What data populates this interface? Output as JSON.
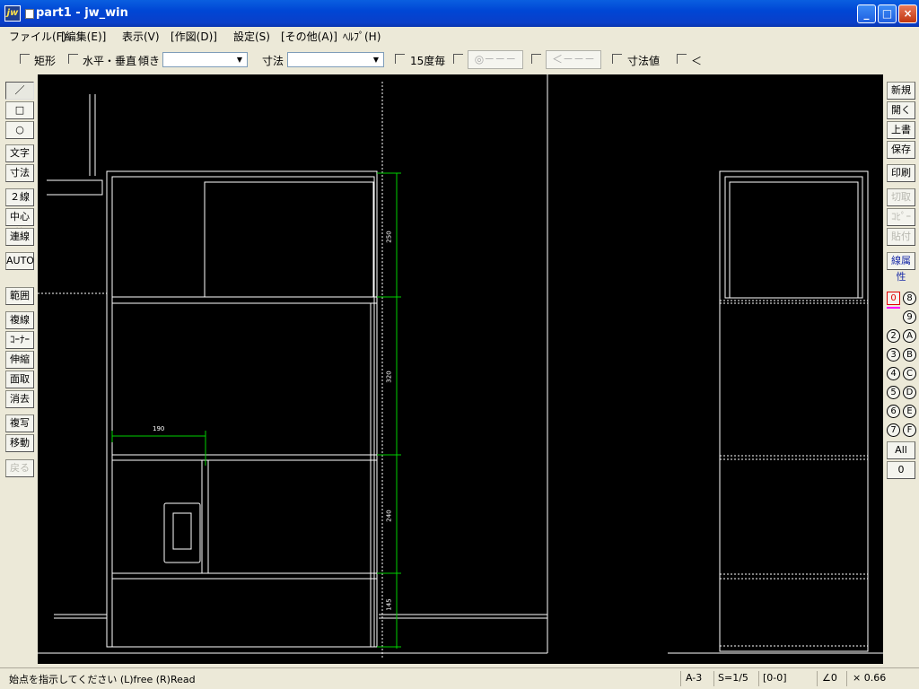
{
  "window": {
    "app_icon": "jw",
    "title": "part1 - jw_win",
    "min_label": "_",
    "max_label": "□",
    "close_label": "×"
  },
  "menu": [
    "ファイル(F)",
    "[編集(E)]",
    "表示(V)",
    "[作図(D)]",
    "設定(S)",
    "[その他(A)]",
    "ﾍﾙﾌﾟ(H)"
  ],
  "toolbar": {
    "rect": "矩形",
    "horiz_vert": "水平・垂直",
    "tilt": "傾き",
    "dim": "寸法",
    "deg15": "15度毎",
    "arrow1": "◎－－－",
    "arrow2": "＜－－－",
    "dimval": "寸法値",
    "lt": "＜"
  },
  "left_tools": [
    "／",
    "□",
    "○",
    "文字",
    "寸法",
    "２線",
    "中心線",
    "連線",
    "AUTO",
    "範囲",
    "複線",
    "ｺｰﾅｰ",
    "伸縮",
    "面取",
    "消去",
    "複写",
    "移動",
    "戻る"
  ],
  "right_tools": [
    "新規",
    "開く",
    "上書",
    "保存",
    "印刷",
    "切取",
    "ｺﾋﾟｰ",
    "貼付",
    "線属性"
  ],
  "layers": {
    "left": [
      "0",
      "",
      "2",
      "3",
      "4",
      "5",
      "6",
      "7"
    ],
    "right": [
      "8",
      "9",
      "A",
      "B",
      "C",
      "D",
      "E",
      "F"
    ],
    "all": "All",
    "zero": "0"
  },
  "drawing": {
    "dims": [
      "250",
      "320",
      "240",
      "145"
    ],
    "width_dim": "190"
  },
  "status": {
    "prompt": "始点を指示してください (L)free (R)Read",
    "paper": "A-3",
    "scale": "S=1/5",
    "layer": "[0-0]",
    "angle": "∠0",
    "zoom": "× 0.66"
  }
}
